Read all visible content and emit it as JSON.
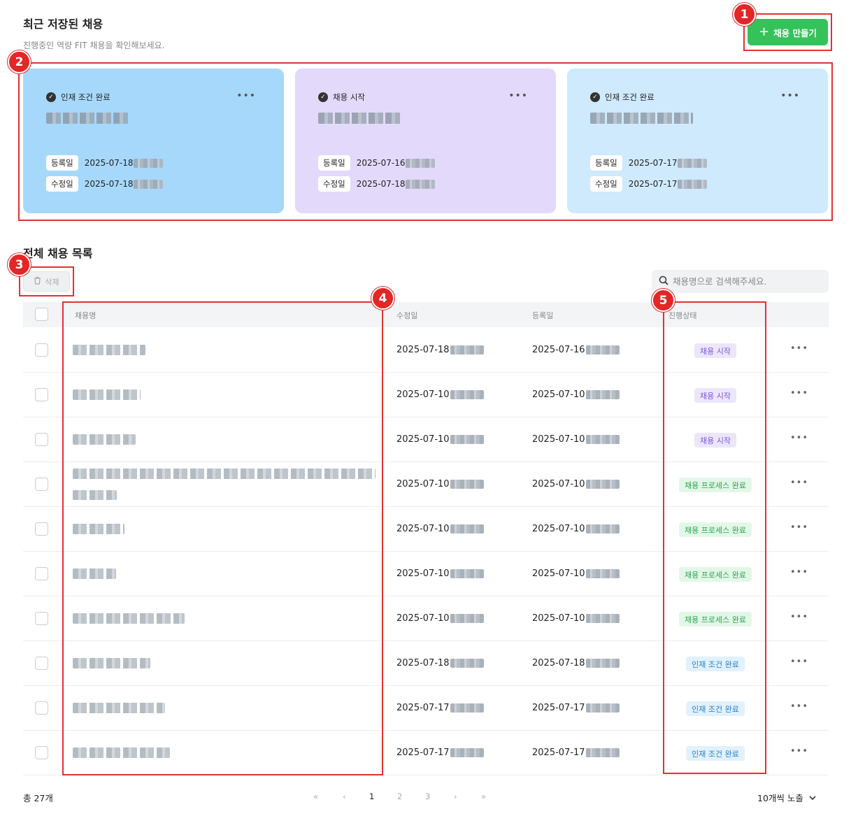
{
  "header": {
    "title": "최근 저장된 채용",
    "subtitle": "진행중인 역량 FIT 채용을 확인해보세요.",
    "create_label": "채용 만들기"
  },
  "cards": [
    {
      "status": "인재 조건 완료",
      "registered_label": "등록일",
      "registered": "2025-07-18",
      "modified_label": "수정일",
      "modified": "2025-07-18",
      "bg": "#a6d8fb"
    },
    {
      "status": "채용 시작",
      "registered_label": "등록일",
      "registered": "2025-07-16",
      "modified_label": "수정일",
      "modified": "2025-07-18",
      "bg": "#e3d9fb"
    },
    {
      "status": "인재 조건 완료",
      "registered_label": "등록일",
      "registered": "2025-07-17",
      "modified_label": "수정일",
      "modified": "2025-07-17",
      "bg": "#cfe9fd"
    }
  ],
  "list": {
    "title": "전체 채용 목록",
    "delete_label": "삭제",
    "search_placeholder": "채용명으로 검색해주세요.",
    "columns": [
      "채용명",
      "수정일",
      "등록일",
      "진행상태"
    ],
    "rows": [
      {
        "modified": "2025-07-18",
        "registered": "2025-07-16",
        "status": "채용 시작",
        "kind": "start"
      },
      {
        "modified": "2025-07-10",
        "registered": "2025-07-10",
        "status": "채용 시작",
        "kind": "start"
      },
      {
        "modified": "2025-07-10",
        "registered": "2025-07-10",
        "status": "채용 시작",
        "kind": "start"
      },
      {
        "modified": "2025-07-10",
        "registered": "2025-07-10",
        "status": "채용 프로세스 완료",
        "kind": "done"
      },
      {
        "modified": "2025-07-10",
        "registered": "2025-07-10",
        "status": "채용 프로세스 완료",
        "kind": "done"
      },
      {
        "modified": "2025-07-10",
        "registered": "2025-07-10",
        "status": "채용 프로세스 완료",
        "kind": "done"
      },
      {
        "modified": "2025-07-10",
        "registered": "2025-07-10",
        "status": "채용 프로세스 완료",
        "kind": "done"
      },
      {
        "modified": "2025-07-18",
        "registered": "2025-07-18",
        "status": "인재 조건 완료",
        "kind": "cand"
      },
      {
        "modified": "2025-07-17",
        "registered": "2025-07-17",
        "status": "인재 조건 완료",
        "kind": "cand"
      },
      {
        "modified": "2025-07-17",
        "registered": "2025-07-17",
        "status": "인재 조건 완료",
        "kind": "cand"
      }
    ]
  },
  "footer": {
    "total": "총 27개",
    "pages": [
      "1",
      "2",
      "3"
    ],
    "first": "«",
    "prev": "‹",
    "next": "›",
    "last": "»",
    "per_page": "10개씩 노출"
  },
  "annotations": [
    "1",
    "2",
    "3",
    "4",
    "5"
  ],
  "colors": {
    "accent_green": "#35c25a",
    "annotation_red": "#e32626"
  }
}
